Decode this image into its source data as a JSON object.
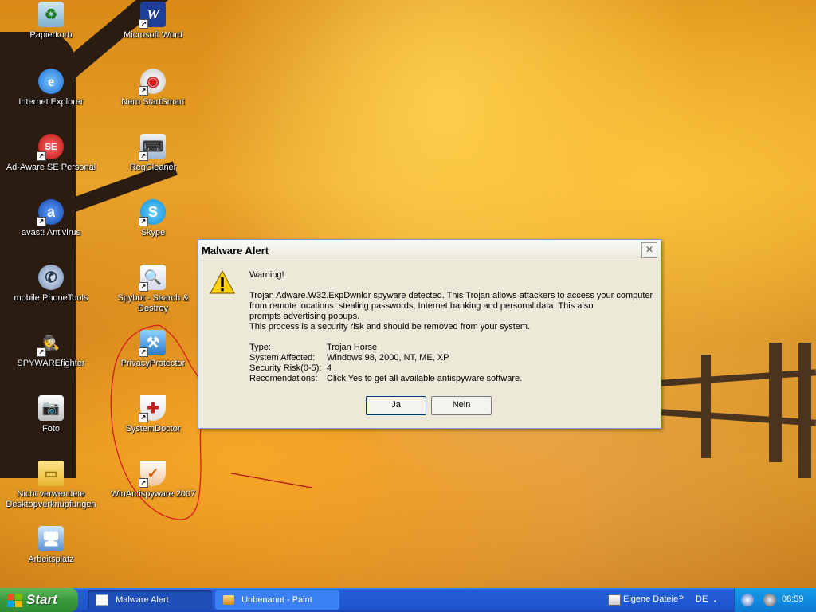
{
  "desktop": {
    "icons": [
      {
        "label": "Papierkorb"
      },
      {
        "label": "Microsoft Word"
      },
      {
        "label": "Internet Explorer"
      },
      {
        "label": "Nero StartSmart"
      },
      {
        "label": "Ad-Aware SE Personal"
      },
      {
        "label": "RegCleaner"
      },
      {
        "label": "avast! Antivirus"
      },
      {
        "label": "Skype"
      },
      {
        "label": "mobile PhoneTools"
      },
      {
        "label": "Spybot - Search & Destroy"
      },
      {
        "label": "SPYWAREfighter"
      },
      {
        "label": "PrivacyProtector"
      },
      {
        "label": "Foto"
      },
      {
        "label": "SystemDoctor"
      },
      {
        "label": "Nicht verwendete Desktopverknüpfungen"
      },
      {
        "label": "WinAntispyware 2007"
      },
      {
        "label": "Arbeitsplatz"
      }
    ]
  },
  "dialog": {
    "title": "Malware Alert",
    "close_glyph": "✕",
    "warning": "Warning!",
    "message_lines": [
      "Trojan Adware.W32.ExpDwnldr spyware detected. This Trojan allows attackers to access your computer",
      "from remote locations, stealing passwords, Internet banking and personal data. This also",
      "prompts advertising popups.",
      "This process is a security risk and should be removed from your system."
    ],
    "details": [
      {
        "key": "Type:",
        "value": "Trojan Horse"
      },
      {
        "key": "System Affected:",
        "value": "Windows 98, 2000, NT, ME, XP"
      },
      {
        "key": "Security Risk(0-5):",
        "value": "4"
      },
      {
        "key": "Recomendations:",
        "value": "Click Yes to get all available antispyware software."
      }
    ],
    "yes_label": "Ja",
    "no_label": "Nein"
  },
  "taskbar": {
    "start_label": "Start",
    "tasks": [
      {
        "label": "Malware Alert"
      },
      {
        "label": "Unbenannt - Paint"
      }
    ],
    "eigene_dateien": "Eigene Dateie",
    "chevron": "»",
    "language": "DE",
    "clock": "08:59"
  },
  "colors": {
    "titlebar_text": "#000000",
    "taskbar_blue": "#245edb",
    "start_green": "#3c9a3c",
    "tray_blue": "#0f8be0",
    "scribble_red": "#d61a1a"
  }
}
